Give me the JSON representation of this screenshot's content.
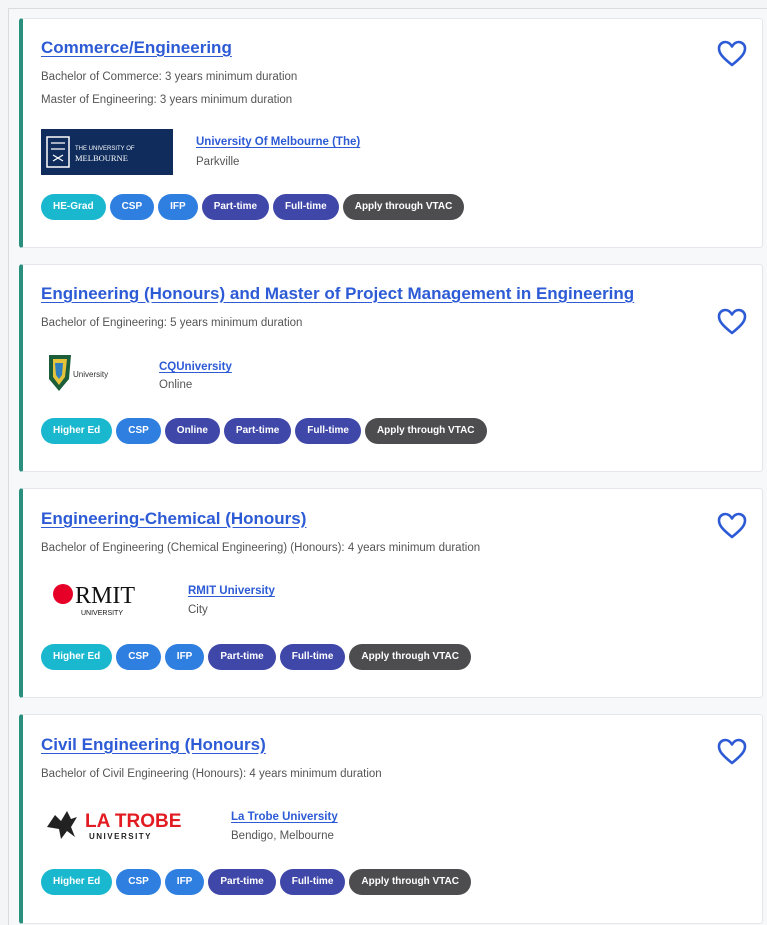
{
  "courses": [
    {
      "title": "Commerce/Engineering",
      "details": [
        "Bachelor of Commerce: 3 years minimum duration",
        "Master of Engineering: 3 years minimum duration"
      ],
      "university": "University Of Melbourne (The)",
      "campus": "Parkville",
      "logo_text": [
        "THE UNIVERSITY OF",
        "MELBOURNE"
      ],
      "tags": [
        "HE-Grad",
        "CSP",
        "IFP",
        "Part-time",
        "Full-time",
        "Apply through VTAC"
      ]
    },
    {
      "title": "Engineering (Honours) and Master of Project Management in Engineering",
      "details": [
        "Bachelor of Engineering: 5 years minimum duration"
      ],
      "university": "CQUniversity",
      "campus": "Online",
      "logo_text": [
        "University"
      ],
      "tags": [
        "Higher Ed",
        "CSP",
        "Online",
        "Part-time",
        "Full-time",
        "Apply through VTAC"
      ]
    },
    {
      "title": "Engineering-Chemical (Honours)",
      "details": [
        "Bachelor of Engineering (Chemical Engineering) (Honours): 4 years minimum duration"
      ],
      "university": "RMIT University",
      "campus": "City",
      "logo_text": [
        "RMIT",
        "UNIVERSITY"
      ],
      "tags": [
        "Higher Ed",
        "CSP",
        "IFP",
        "Part-time",
        "Full-time",
        "Apply through VTAC"
      ]
    },
    {
      "title": "Civil Engineering (Honours)",
      "details": [
        "Bachelor of Civil Engineering (Honours): 4 years minimum duration"
      ],
      "university": "La Trobe University",
      "campus": "Bendigo, Melbourne",
      "logo_text": [
        "LA TROBE",
        "UNIVERSITY"
      ],
      "tags": [
        "Higher Ed",
        "CSP",
        "IFP",
        "Part-time",
        "Full-time",
        "Apply through VTAC"
      ]
    }
  ],
  "colors": {
    "accent_bar": "#2b8f7e",
    "link": "#2d5bd6",
    "tag_teal": "#1ab8cf",
    "tag_blue": "#2f7fe0",
    "tag_purple": "#3f47a9",
    "tag_grey": "#4d4d4f"
  },
  "icons": {
    "favourite": "heart-outline-icon"
  }
}
